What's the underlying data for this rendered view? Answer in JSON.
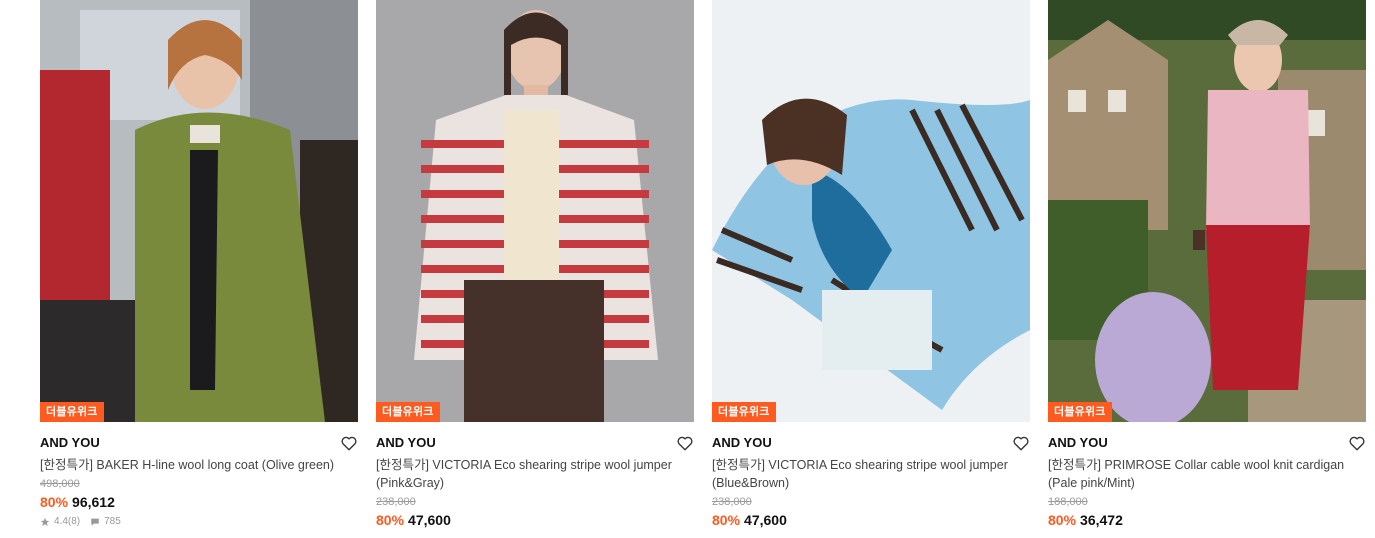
{
  "products": [
    {
      "badge": "더블유위크",
      "brand": "AND YOU",
      "title": "[한정특가] BAKER H-line wool long coat (Olive green)",
      "original_price": "498,000",
      "discount": "80%",
      "price": "96,612",
      "rating": "4.4(8)",
      "likes": "785"
    },
    {
      "badge": "더블유위크",
      "brand": "AND YOU",
      "title": "[한정특가] VICTORIA Eco shearing stripe wool jumper (Pink&Gray)",
      "original_price": "238,000",
      "discount": "80%",
      "price": "47,600"
    },
    {
      "badge": "더블유위크",
      "brand": "AND YOU",
      "title": "[한정특가] VICTORIA Eco shearing stripe wool jumper (Blue&Brown)",
      "original_price": "238,000",
      "discount": "80%",
      "price": "47,600"
    },
    {
      "badge": "더블유위크",
      "brand": "AND YOU",
      "title": "[한정특가] PRIMROSE Collar cable wool knit cardigan (Pale pink/Mint)",
      "original_price": "188,000",
      "discount": "80%",
      "price": "36,472"
    }
  ],
  "colors": {
    "accent": "#ff5a1f",
    "text": "#222222",
    "muted": "#9a9a9a"
  },
  "icons": {
    "wishlist": "heart-outline-icon",
    "rating": "star-icon",
    "likes": "comment-icon"
  }
}
